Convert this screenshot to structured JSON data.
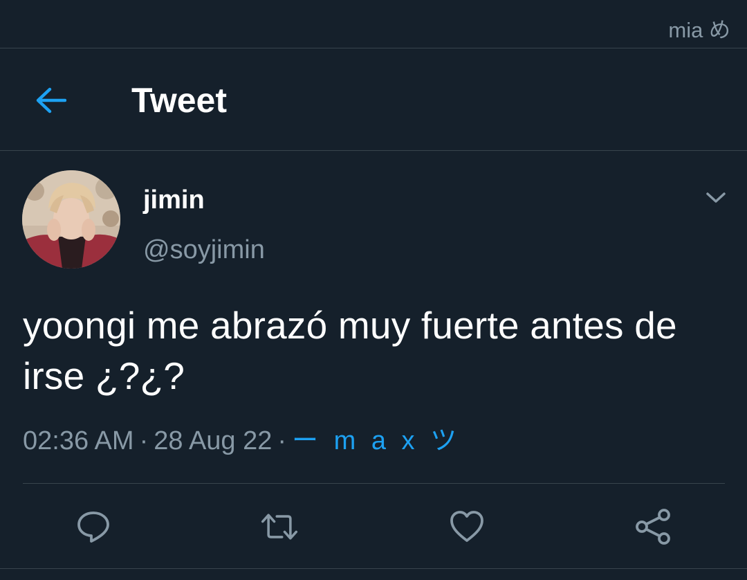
{
  "status_bar": {
    "text": "mia め"
  },
  "header": {
    "title": "Tweet",
    "back_icon": "arrow-left-icon"
  },
  "tweet": {
    "author": {
      "display_name": "jimin",
      "handle": "@soyjimin"
    },
    "text": "yoongi me abrazó muy fuerte antes de irse ¿?¿?",
    "time": "02:36 AM",
    "separator": "·",
    "date": "28 Aug 22",
    "source": "ー m a x ツ"
  },
  "actions": [
    {
      "name": "reply",
      "icon": "reply-icon"
    },
    {
      "name": "retweet",
      "icon": "retweet-icon"
    },
    {
      "name": "like",
      "icon": "heart-icon"
    },
    {
      "name": "share",
      "icon": "share-icon"
    }
  ],
  "colors": {
    "background": "#15202b",
    "divider": "#38444d",
    "secondary_text": "#8899a6",
    "accent": "#1da1f2",
    "primary_text": "#ffffff"
  }
}
